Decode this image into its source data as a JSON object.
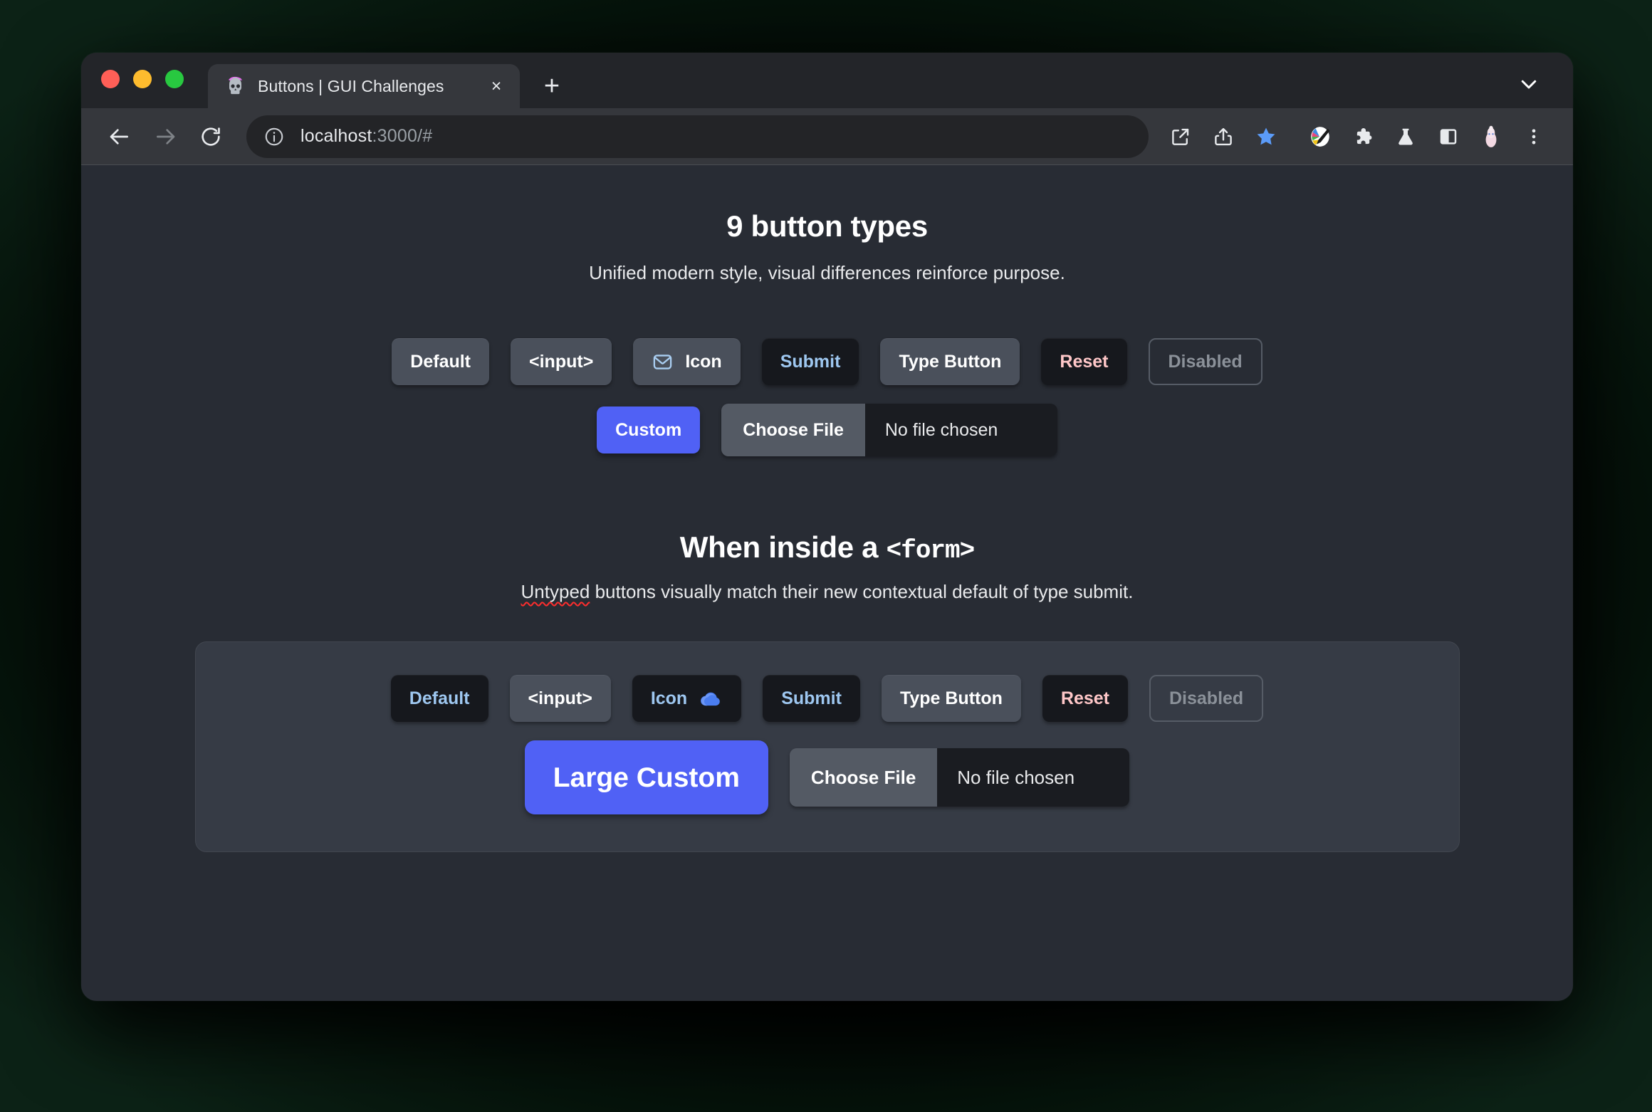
{
  "browser": {
    "traffic_lights": [
      "close",
      "minimize",
      "zoom"
    ],
    "tab": {
      "favicon": "skull-party-icon",
      "title": "Buttons | GUI Challenges",
      "close_label": "×"
    },
    "new_tab_label": "+",
    "tabstrip_chevron": "chevron-down-icon",
    "toolbar": {
      "back": "back-arrow-icon",
      "forward": "forward-arrow-icon",
      "reload": "reload-icon",
      "site_info": "info-icon",
      "url_host": "localhost",
      "url_rest": ":3000/#",
      "actions": [
        {
          "name": "open-in-new-icon",
          "glyph": "open-in-new"
        },
        {
          "name": "share-icon",
          "glyph": "share"
        },
        {
          "name": "bookmark-star-icon",
          "glyph": "star"
        },
        {
          "name": "colorpicker-extension-icon",
          "glyph": "palette"
        },
        {
          "name": "extensions-puzzle-icon",
          "glyph": "puzzle"
        },
        {
          "name": "labs-flask-icon",
          "glyph": "flask"
        },
        {
          "name": "side-panel-icon",
          "glyph": "panel"
        },
        {
          "name": "profile-avatar-icon",
          "glyph": "avatar"
        },
        {
          "name": "browser-menu-icon",
          "glyph": "kebab"
        }
      ]
    }
  },
  "page": {
    "heading": "9 button types",
    "subheading": "Unified modern style, visual differences reinforce purpose.",
    "row1": [
      {
        "label": "Default",
        "style": "neutral",
        "icon": null
      },
      {
        "label": "<input>",
        "style": "neutral",
        "icon": null
      },
      {
        "label": "Icon",
        "style": "neutral",
        "icon": "envelope-icon",
        "icon_side": "left"
      },
      {
        "label": "Submit",
        "style": "submit",
        "icon": null
      },
      {
        "label": "Type Button",
        "style": "neutral",
        "icon": null
      },
      {
        "label": "Reset",
        "style": "reset",
        "icon": null
      },
      {
        "label": "Disabled",
        "style": "disabled",
        "icon": null
      }
    ],
    "row2": {
      "custom_label": "Custom",
      "file": {
        "choose_label": "Choose File",
        "chosen_text": "No file chosen"
      }
    },
    "form_heading_text": "When inside a ",
    "form_heading_mono": "<form>",
    "form_sub_misspelled": "Untyped",
    "form_sub_rest": " buttons visually match their new contextual default of type submit.",
    "form_row1": [
      {
        "label": "Default",
        "style": "submit",
        "icon": null
      },
      {
        "label": "<input>",
        "style": "neutral",
        "icon": null
      },
      {
        "label": "Icon",
        "style": "submit",
        "icon": "cloud-icon",
        "icon_side": "right"
      },
      {
        "label": "Submit",
        "style": "submit",
        "icon": null
      },
      {
        "label": "Type Button",
        "style": "neutral",
        "icon": null
      },
      {
        "label": "Reset",
        "style": "reset",
        "icon": null
      },
      {
        "label": "Disabled",
        "style": "disabled",
        "icon": null
      }
    ],
    "form_row2": {
      "custom_label": "Large Custom",
      "file": {
        "choose_label": "Choose File",
        "chosen_text": "No file chosen"
      }
    }
  },
  "colors": {
    "page_bg": "#282c34",
    "neutral_btn": "#4a505b",
    "dark_btn": "#16181d",
    "brand": "#5061f5",
    "submit_text": "#9ec7f0",
    "reset_text": "#ffc7c8",
    "disabled_text": "#8b9199",
    "form_box_bg": "#363b45",
    "toolbar_bg": "#35373c",
    "tabstrip_bg": "#232529"
  }
}
